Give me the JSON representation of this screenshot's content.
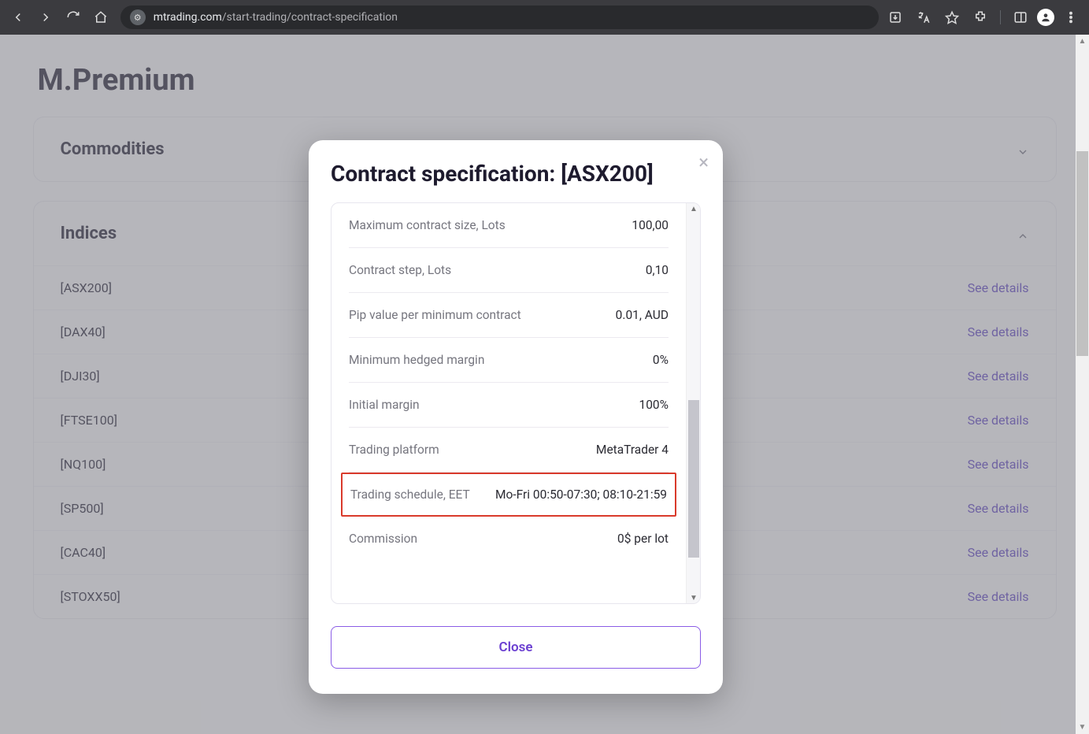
{
  "browser": {
    "url_host": "mtrading.com",
    "url_path": "/start-trading/contract-specification"
  },
  "page": {
    "title": "M.Premium",
    "accordion_commodities": "Commodities",
    "accordion_indices": "Indices",
    "see_details": "See details",
    "indices": [
      "[ASX200]",
      "[DAX40]",
      "[DJI30]",
      "[FTSE100]",
      "[NQ100]",
      "[SP500]",
      "[CAC40]",
      "[STOXX50]"
    ]
  },
  "modal": {
    "title": "Contract specification: [ASX200]",
    "close_label": "Close",
    "rows": {
      "max_contract_label": "Maximum contract size, Lots",
      "max_contract_value": "100,00",
      "contract_step_label": "Contract step, Lots",
      "contract_step_value": "0,10",
      "pip_value_label": "Pip value per minimum contract",
      "pip_value_value": "0.01, AUD",
      "min_hedged_label": "Minimum hedged margin",
      "min_hedged_value": "0%",
      "initial_margin_label": "Initial margin",
      "initial_margin_value": "100%",
      "platform_label": "Trading platform",
      "platform_value": "MetaTrader 4",
      "schedule_label": "Trading schedule, EET",
      "schedule_value": "Mo-Fri 00:50-07:30; 08:10-21:59",
      "commission_label": "Commission",
      "commission_value": "0$ per lot"
    }
  }
}
